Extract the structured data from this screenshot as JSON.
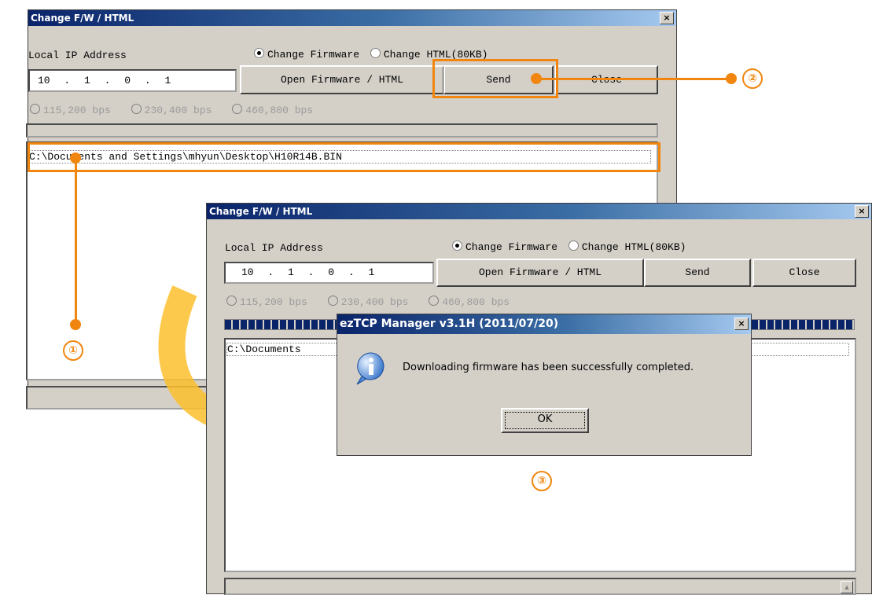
{
  "back_window": {
    "title": "Change F/W / HTML",
    "close_glyph": "×",
    "ip_label": "Local IP Address",
    "mode_firmware": "Change Firmware",
    "mode_html": "Change HTML(80KB)",
    "ip": [
      "10",
      "1",
      "0",
      "1"
    ],
    "open_button": "Open Firmware / HTML",
    "send_button": "Send",
    "close_button": "Close",
    "baud_options": [
      "115,200 bps",
      "230,400 bps",
      "460,800 bps"
    ],
    "file_path": "C:\\Documents and Settings\\mhyun\\Desktop\\H10R14B.BIN"
  },
  "front_window": {
    "title": "Change F/W / HTML",
    "close_glyph": "×",
    "ip_label": "Local IP Address",
    "mode_firmware": "Change Firmware",
    "mode_html": "Change HTML(80KB)",
    "ip": [
      "10",
      "1",
      "0",
      "1"
    ],
    "open_button": "Open Firmware / HTML",
    "send_button": "Send",
    "close_button": "Close",
    "baud_options": [
      "115,200 bps",
      "230,400 bps",
      "460,800 bps"
    ],
    "file_path": "C:\\Documents",
    "scroll_up_glyph": "▲"
  },
  "dialog": {
    "title": "ezTCP Manager v3.1H (2011/07/20)",
    "close_glyph": "×",
    "message": "Downloading firmware has been successfully completed.",
    "ok_button": "OK",
    "icon": "info-icon"
  },
  "callouts": {
    "one": "①",
    "two": "②",
    "three": "③"
  },
  "colors": {
    "accent": "#f0860f",
    "arrow": "#fbc02d",
    "titlebar": "#0a246a"
  }
}
